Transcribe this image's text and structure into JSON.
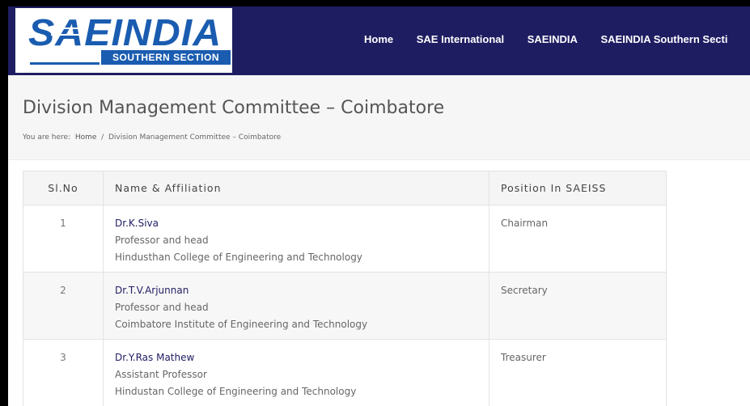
{
  "logo": {
    "word": "SAEINDIA",
    "sub": "SOUTHERN SECTION"
  },
  "nav": {
    "items": [
      "Home",
      "SAE International",
      "SAEINDIA",
      "SAEINDIA Southern Secti"
    ]
  },
  "page": {
    "title": "Division Management Committee – Coimbatore"
  },
  "breadcrumb": {
    "prefix": "You are here:",
    "home": "Home",
    "separator": "/",
    "current": "Division Management Committee – Coimbatore"
  },
  "table": {
    "headers": [
      "Sl.No",
      "Name & Affiliation",
      "Position In SAEISS"
    ],
    "rows": [
      {
        "sl": "1",
        "name": "Dr.K.Siva",
        "designation": "Professor and head",
        "institution": "Hindusthan College of Engineering and Technology",
        "position": "Chairman"
      },
      {
        "sl": "2",
        "name": "Dr.T.V.Arjunnan",
        "designation": "Professor and head",
        "institution": "Coimbatore Institute of Engineering and Technology",
        "position": "Secretary"
      },
      {
        "sl": "3",
        "name": "Dr.Y.Ras Mathew",
        "designation": "Assistant Professor",
        "institution": "Hindustan College of Engineering and Technology",
        "position": "Treasurer"
      }
    ]
  },
  "colors": {
    "header_bg": "#1f1d62",
    "logo_blue": "#1a5cb0",
    "title_band": "#f6f6f6"
  }
}
